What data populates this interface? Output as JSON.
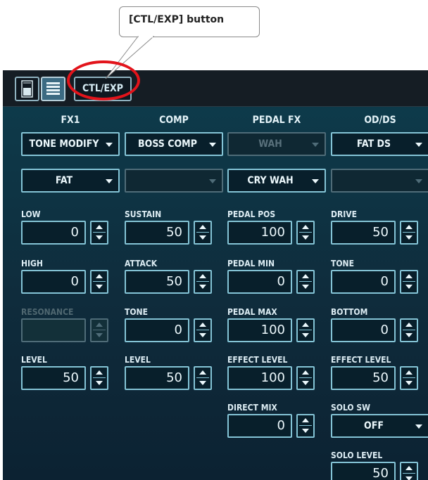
{
  "callout": {
    "text": "[CTL/EXP] button"
  },
  "toolbar": {
    "ctl_exp_label": "CTL/EXP"
  },
  "columns": [
    {
      "header": "FX1",
      "type": {
        "value": "TONE MODIFY",
        "disabled": false
      },
      "variation": {
        "value": "FAT",
        "disabled": false
      },
      "params": [
        {
          "label": "LOW",
          "value": "0",
          "disabled": false
        },
        {
          "label": "HIGH",
          "value": "0",
          "disabled": false
        },
        {
          "label": "RESONANCE",
          "value": "",
          "disabled": true
        },
        {
          "label": "LEVEL",
          "value": "50",
          "disabled": false
        }
      ]
    },
    {
      "header": "COMP",
      "type": {
        "value": "BOSS COMP",
        "disabled": false
      },
      "variation": {
        "value": "",
        "disabled": true
      },
      "params": [
        {
          "label": "SUSTAIN",
          "value": "50",
          "disabled": false
        },
        {
          "label": "ATTACK",
          "value": "50",
          "disabled": false
        },
        {
          "label": "TONE",
          "value": "0",
          "disabled": false
        },
        {
          "label": "LEVEL",
          "value": "50",
          "disabled": false
        }
      ]
    },
    {
      "header": "PEDAL FX",
      "type": {
        "value": "WAH",
        "disabled": true
      },
      "variation": {
        "value": "CRY WAH",
        "disabled": false
      },
      "params": [
        {
          "label": "PEDAL POS",
          "value": "100",
          "disabled": false
        },
        {
          "label": "PEDAL MIN",
          "value": "0",
          "disabled": false
        },
        {
          "label": "PEDAL MAX",
          "value": "100",
          "disabled": false
        },
        {
          "label": "EFFECT LEVEL",
          "value": "100",
          "disabled": false
        },
        {
          "label": "DIRECT MIX",
          "value": "0",
          "disabled": false
        }
      ]
    },
    {
      "header": "OD/DS",
      "type": {
        "value": "FAT DS",
        "disabled": false
      },
      "variation": {
        "value": "",
        "disabled": true
      },
      "params": [
        {
          "label": "DRIVE",
          "value": "50",
          "disabled": false
        },
        {
          "label": "TONE",
          "value": "0",
          "disabled": false
        },
        {
          "label": "BOTTOM",
          "value": "0",
          "disabled": false
        },
        {
          "label": "EFFECT LEVEL",
          "value": "50",
          "disabled": false
        },
        {
          "label": "SOLO SW",
          "value": "OFF",
          "disabled": false,
          "kind": "dropdown"
        },
        {
          "label": "SOLO LEVEL",
          "value": "50",
          "disabled": false
        }
      ]
    }
  ]
}
